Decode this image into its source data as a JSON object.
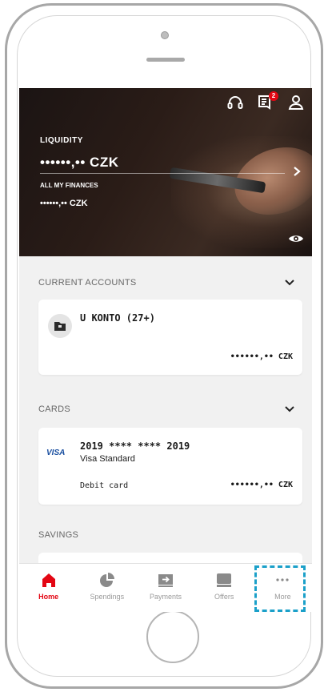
{
  "hero": {
    "liquidity_label": "LIQUIDITY",
    "liquidity_amount": "••••••,•• CZK",
    "all_finances_label": "ALL MY FINANCES",
    "all_finances_amount": "••••••,•• CZK",
    "notification_count": "2",
    "icons": [
      "headset-icon",
      "messages-icon",
      "profile-icon",
      "chevron-right-icon",
      "eye-icon"
    ]
  },
  "current_accounts": {
    "title": "CURRENT ACCOUNTS",
    "account_name": "U KONTO (27+)",
    "amount": "••••••,•• CZK"
  },
  "cards": {
    "title": "CARDS",
    "brand": "VISA",
    "number": "2019 **** **** 2019",
    "type": "Visa Standard",
    "kind": "Debit card",
    "amount": "••••••,•• CZK"
  },
  "savings": {
    "title": "SAVINGS"
  },
  "nav": {
    "items": [
      {
        "label": "Home",
        "icon": "home-icon",
        "active": true
      },
      {
        "label": "Spendings",
        "icon": "pie-chart-icon",
        "active": false
      },
      {
        "label": "Payments",
        "icon": "payments-icon",
        "active": false
      },
      {
        "label": "Offers",
        "icon": "offers-icon",
        "active": false
      },
      {
        "label": "More",
        "icon": "more-icon",
        "active": false
      }
    ]
  },
  "colors": {
    "accent": "#e30613",
    "highlight": "#1ba0c9",
    "visa": "#1a4fa0"
  }
}
